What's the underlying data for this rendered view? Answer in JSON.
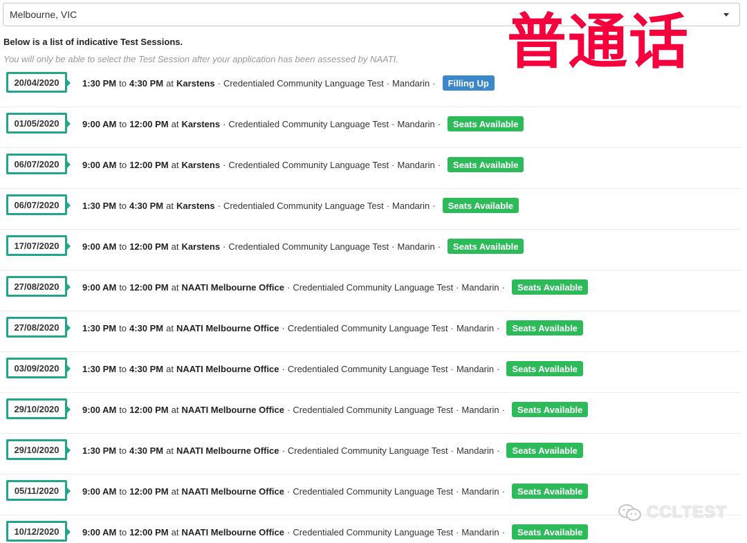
{
  "location_select": {
    "value": "Melbourne, VIC"
  },
  "heading": "Below is a list of indicative Test Sessions.",
  "note": "You will only be able to select the Test Session after your application has been assessed by NAATI.",
  "watermark": {
    "chinese": "普通话",
    "brand": "CCLTEST"
  },
  "labels": {
    "to": "to",
    "at": "at",
    "sep": "·"
  },
  "sessions": [
    {
      "date": "20/04/2020",
      "start": "1:30 PM",
      "end": "4:30 PM",
      "venue": "Karstens",
      "test": "Credentialed Community Language Test",
      "language": "Mandarin",
      "status": "Filling Up",
      "status_color": "#3a87c9"
    },
    {
      "date": "01/05/2020",
      "start": "9:00 AM",
      "end": "12:00 PM",
      "venue": "Karstens",
      "test": "Credentialed Community Language Test",
      "language": "Mandarin",
      "status": "Seats Available",
      "status_color": "#2dbb5a"
    },
    {
      "date": "06/07/2020",
      "start": "9:00 AM",
      "end": "12:00 PM",
      "venue": "Karstens",
      "test": "Credentialed Community Language Test",
      "language": "Mandarin",
      "status": "Seats Available",
      "status_color": "#2dbb5a"
    },
    {
      "date": "06/07/2020",
      "start": "1:30 PM",
      "end": "4:30 PM",
      "venue": "Karstens",
      "test": "Credentialed Community Language Test",
      "language": "Mandarin",
      "status": "Seats Available",
      "status_color": "#2dbb5a"
    },
    {
      "date": "17/07/2020",
      "start": "9:00 AM",
      "end": "12:00 PM",
      "venue": "Karstens",
      "test": "Credentialed Community Language Test",
      "language": "Mandarin",
      "status": "Seats Available",
      "status_color": "#2dbb5a"
    },
    {
      "date": "27/08/2020",
      "start": "9:00 AM",
      "end": "12:00 PM",
      "venue": "NAATI Melbourne Office",
      "test": "Credentialed Community Language Test",
      "language": "Mandarin",
      "status": "Seats Available",
      "status_color": "#2dbb5a"
    },
    {
      "date": "27/08/2020",
      "start": "1:30 PM",
      "end": "4:30 PM",
      "venue": "NAATI Melbourne Office",
      "test": "Credentialed Community Language Test",
      "language": "Mandarin",
      "status": "Seats Available",
      "status_color": "#2dbb5a"
    },
    {
      "date": "03/09/2020",
      "start": "1:30 PM",
      "end": "4:30 PM",
      "venue": "NAATI Melbourne Office",
      "test": "Credentialed Community Language Test",
      "language": "Mandarin",
      "status": "Seats Available",
      "status_color": "#2dbb5a"
    },
    {
      "date": "29/10/2020",
      "start": "9:00 AM",
      "end": "12:00 PM",
      "venue": "NAATI Melbourne Office",
      "test": "Credentialed Community Language Test",
      "language": "Mandarin",
      "status": "Seats Available",
      "status_color": "#2dbb5a"
    },
    {
      "date": "29/10/2020",
      "start": "1:30 PM",
      "end": "4:30 PM",
      "venue": "NAATI Melbourne Office",
      "test": "Credentialed Community Language Test",
      "language": "Mandarin",
      "status": "Seats Available",
      "status_color": "#2dbb5a"
    },
    {
      "date": "05/11/2020",
      "start": "9:00 AM",
      "end": "12:00 PM",
      "venue": "NAATI Melbourne Office",
      "test": "Credentialed Community Language Test",
      "language": "Mandarin",
      "status": "Seats Available",
      "status_color": "#2dbb5a"
    },
    {
      "date": "10/12/2020",
      "start": "9:00 AM",
      "end": "12:00 PM",
      "venue": "NAATI Melbourne Office",
      "test": "Credentialed Community Language Test",
      "language": "Mandarin",
      "status": "Seats Available",
      "status_color": "#2dbb5a"
    }
  ]
}
